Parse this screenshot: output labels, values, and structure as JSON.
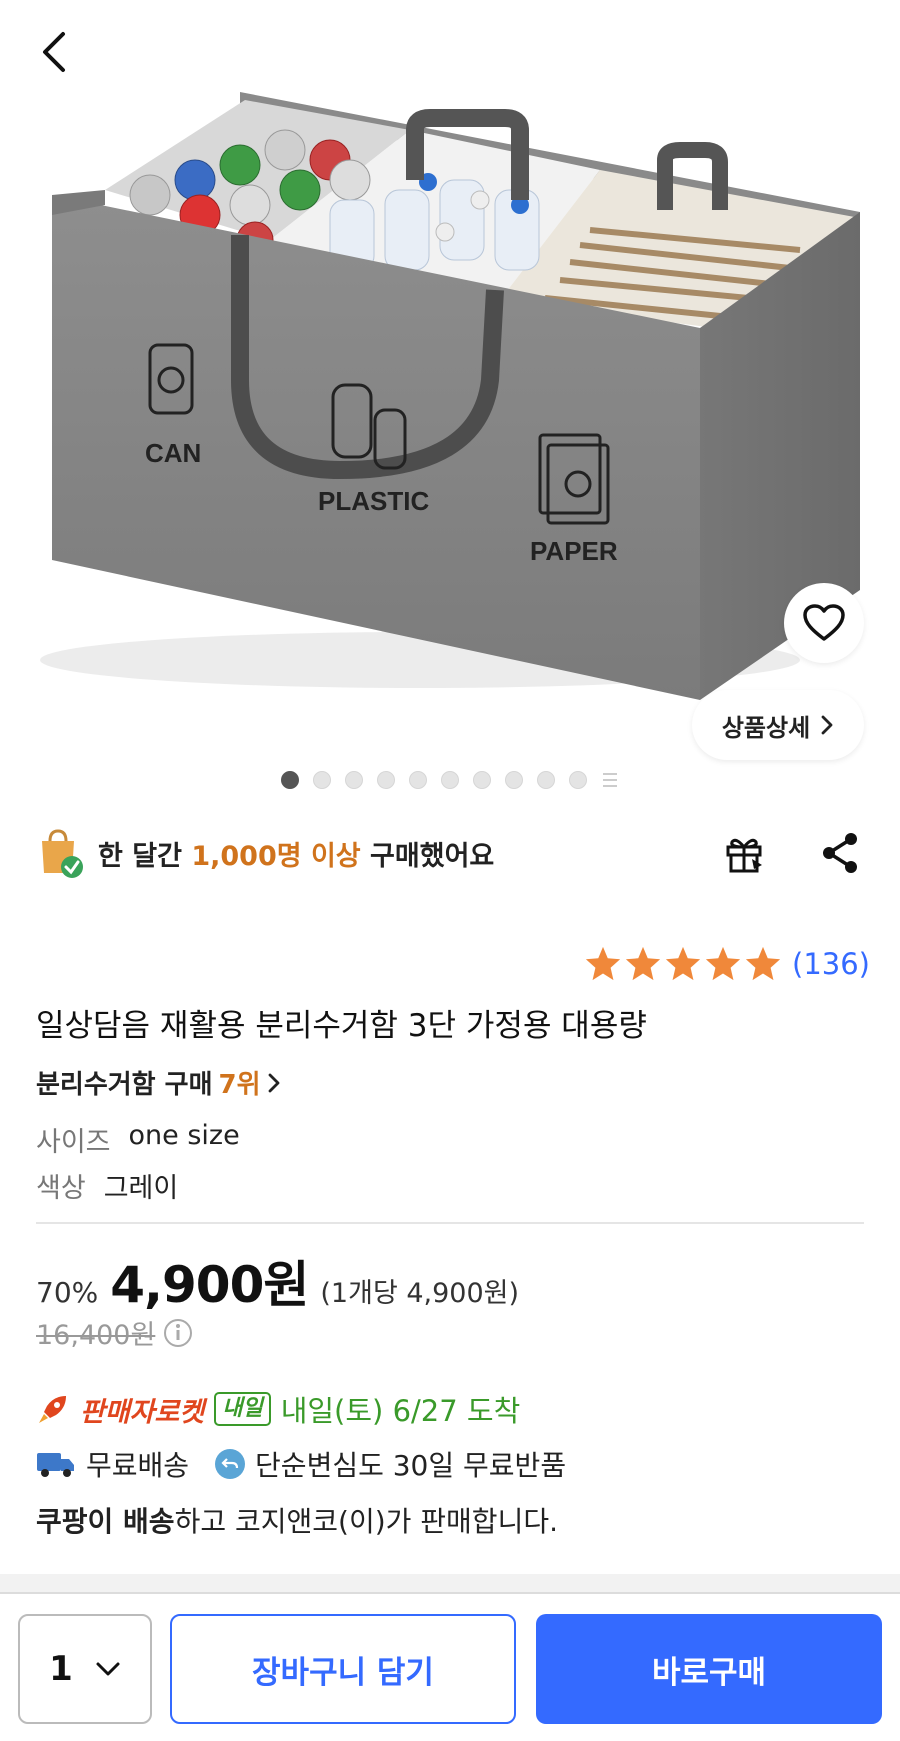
{
  "hero": {
    "bag_labels": [
      "CAN",
      "PLASTIC",
      "PAPER"
    ],
    "detail_label": "상품상세",
    "carousel": {
      "total_dots": 10,
      "active_index": 0
    }
  },
  "social_proof": {
    "prefix": "한 달간 ",
    "highlight": "1,000명 이상",
    "suffix": " 구매했어요"
  },
  "rating": {
    "stars": 5,
    "count": "(136)"
  },
  "product": {
    "title": "일상담음 재활용 분리수거함 3단 가정용 대용량",
    "rank_prefix": "분리수거함 구매 ",
    "rank_value": "7위"
  },
  "options": [
    {
      "key": "사이즈",
      "value": "one size"
    },
    {
      "key": "색상",
      "value": "그레이"
    }
  ],
  "price": {
    "discount": "70%",
    "sale": "4,900원",
    "unit": "(1개당 4,900원)",
    "original": "16,400원"
  },
  "delivery": {
    "rocket_label": "판매자로켓",
    "badge": "내일",
    "arrival": "내일(토) 6/27 도착",
    "free_shipping": "무료배송",
    "free_return": "단순변심도 30일 무료반품",
    "seller_bold": "쿠팡이 배송",
    "seller_rest": "하고 코지앤코(이)가 판매합니다."
  },
  "bottom": {
    "quantity": "1",
    "cart_label": "장바구니 담기",
    "buy_label": "바로구매"
  },
  "colors": {
    "accent_blue": "#346aff",
    "highlight_orange": "#d0731c",
    "star_orange": "#f0883a",
    "rocket_red": "#e0461e",
    "arrival_green": "#3a9a2a"
  }
}
